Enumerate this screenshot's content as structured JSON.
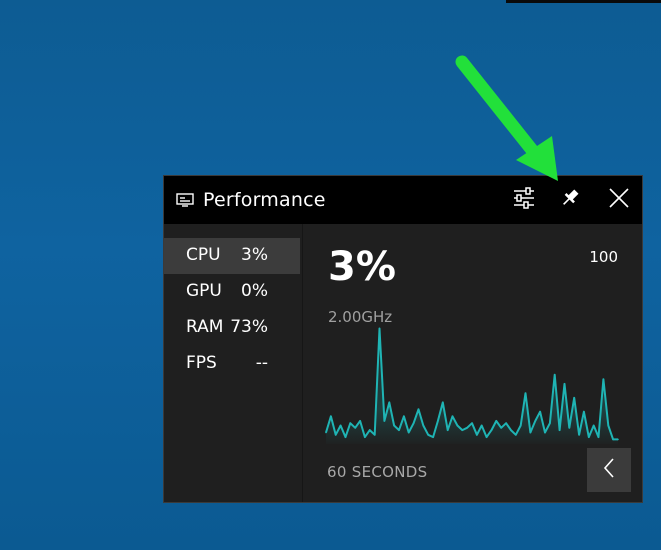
{
  "window": {
    "title": "Performance"
  },
  "titlebar": {
    "icons": [
      "performance-icon",
      "settings-icon",
      "pin-icon",
      "close-icon"
    ]
  },
  "metrics": [
    {
      "label": "CPU",
      "value": "3%",
      "selected": true
    },
    {
      "label": "GPU",
      "value": "0%",
      "selected": false
    },
    {
      "label": "RAM",
      "value": "73%",
      "selected": false
    },
    {
      "label": "FPS",
      "value": "--",
      "selected": false
    }
  ],
  "main": {
    "current_value": "3%",
    "max_value": "100",
    "frequency": "2.00GHz",
    "duration_label": "60 SECONDS"
  },
  "chart_data": {
    "type": "line",
    "ylim": [
      0,
      100
    ],
    "values": [
      5,
      12,
      4,
      8,
      3,
      9,
      7,
      10,
      3,
      6,
      4,
      50,
      10,
      18,
      8,
      6,
      12,
      5,
      9,
      15,
      8,
      4,
      3,
      10,
      18,
      6,
      12,
      8,
      6,
      7,
      9,
      4,
      8,
      3,
      6,
      10,
      7,
      9,
      6,
      4,
      8,
      22,
      5,
      10,
      14,
      5,
      9,
      30,
      6,
      26,
      7,
      20,
      4,
      14,
      3,
      8,
      3,
      28,
      8,
      2,
      2
    ],
    "color": "#1fb4b4"
  },
  "colors": {
    "accent_graph": "#1fb4b4",
    "arrow": "#22e03a",
    "titlebar": "#000000",
    "panel": "#1f1f1f"
  }
}
